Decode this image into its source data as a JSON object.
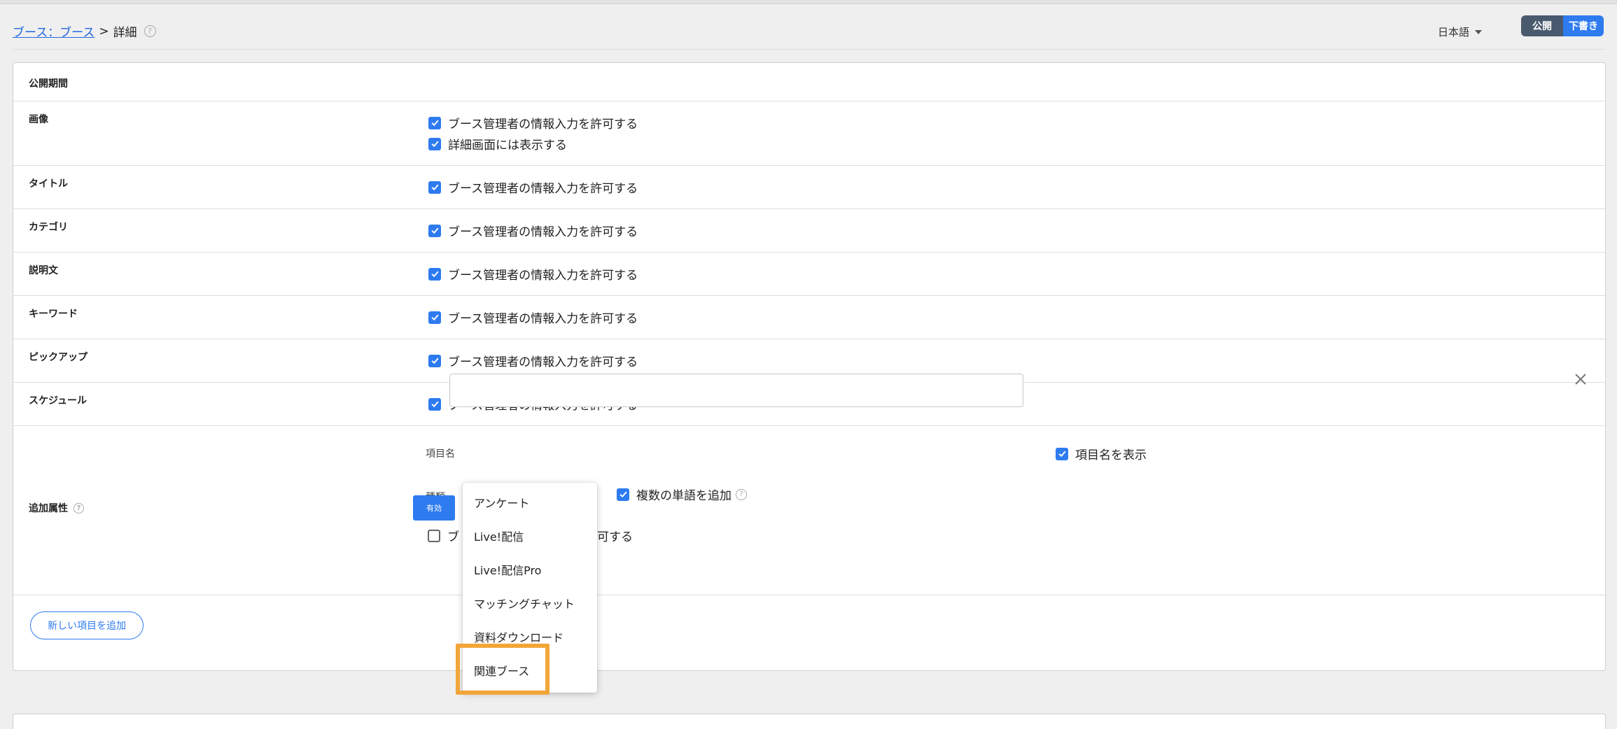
{
  "breadcrumb": {
    "link": "ブース：ブース",
    "separator": ">",
    "current": "詳細"
  },
  "language": {
    "selected": "日本語"
  },
  "status_toggle": {
    "publish": "公開",
    "draft": "下書き"
  },
  "sections": {
    "period_label": "公開期間",
    "image_label": "画像",
    "title_label": "タイトル",
    "category_label": "カテゴリ",
    "description_label": "説明文",
    "keyword_label": "キーワード",
    "pickup_label": "ピックアップ",
    "schedule_label": "スケジュール",
    "extra_label": "追加属性"
  },
  "options": {
    "allow_input": "ブース管理者の情報入力を許可する",
    "show_detail": "詳細画面には表示する"
  },
  "extra": {
    "item_name_label": "項目名",
    "item_name_value": "",
    "show_item_name": "項目名を表示",
    "type_label": "種類",
    "multiple_words": "複数の単語を追加",
    "allow_partial_left": "ブ",
    "allow_partial_right": "可する",
    "enable_button": "有効"
  },
  "add_item_button": "新しい項目を追加",
  "type_dropdown": {
    "items": [
      "アンケート",
      "Live!配信",
      "Live!配信Pro",
      "マッチングチャット",
      "資料ダウンロード",
      "関連ブース"
    ],
    "highlighted": "関連ブース"
  },
  "colors": {
    "accent": "#2e7bf0",
    "highlight": "#f2a63a",
    "toggle_dark": "#4a5a6e"
  }
}
